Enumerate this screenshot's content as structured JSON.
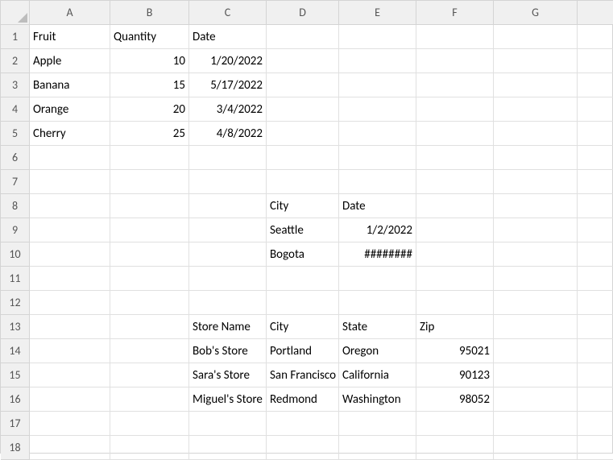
{
  "columns": [
    "A",
    "B",
    "C",
    "D",
    "E",
    "F",
    "G",
    ""
  ],
  "rows": [
    "1",
    "2",
    "3",
    "4",
    "5",
    "6",
    "7",
    "8",
    "9",
    "10",
    "11",
    "12",
    "13",
    "14",
    "15",
    "16",
    "17",
    "18"
  ],
  "cells": {
    "r1": {
      "A": "Fruit",
      "B": "Quantity",
      "C": "Date"
    },
    "r2": {
      "A": "Apple",
      "B": "10",
      "C": "1/20/2022"
    },
    "r3": {
      "A": "Banana",
      "B": "15",
      "C": "5/17/2022"
    },
    "r4": {
      "A": "Orange",
      "B": "20",
      "C": "3/4/2022"
    },
    "r5": {
      "A": "Cherry",
      "B": "25",
      "C": "4/8/2022"
    },
    "r8": {
      "D": "City",
      "E": "Date"
    },
    "r9": {
      "D": "Seattle",
      "E": "1/2/2022"
    },
    "r10": {
      "D": "Bogota",
      "E": "########"
    },
    "r13": {
      "C": "Store Name",
      "D": "City",
      "E": "State",
      "F": "Zip"
    },
    "r14": {
      "C": "Bob's Store",
      "D": "Portland",
      "E": "Oregon",
      "F": "95021"
    },
    "r15": {
      "C": "Sara's Store",
      "D": "San Francisco",
      "E": "California",
      "F": "90123"
    },
    "r16": {
      "C": "Miguel's Store",
      "D": "Redmond",
      "E": "Washington",
      "F": "98052"
    }
  },
  "chart_data": [
    {
      "type": "table",
      "title": "Fruit Quantities",
      "columns": [
        "Fruit",
        "Quantity",
        "Date"
      ],
      "rows": [
        [
          "Apple",
          10,
          "1/20/2022"
        ],
        [
          "Banana",
          15,
          "5/17/2022"
        ],
        [
          "Orange",
          20,
          "3/4/2022"
        ],
        [
          "Cherry",
          25,
          "4/8/2022"
        ]
      ]
    },
    {
      "type": "table",
      "title": "City Dates",
      "columns": [
        "City",
        "Date"
      ],
      "rows": [
        [
          "Seattle",
          "1/2/2022"
        ],
        [
          "Bogota",
          "########"
        ]
      ]
    },
    {
      "type": "table",
      "title": "Stores",
      "columns": [
        "Store Name",
        "City",
        "State",
        "Zip"
      ],
      "rows": [
        [
          "Bob's Store",
          "Portland",
          "Oregon",
          95021
        ],
        [
          "Sara's Store",
          "San Francisco",
          "California",
          90123
        ],
        [
          "Miguel's Store",
          "Redmond",
          "Washington",
          98052
        ]
      ]
    }
  ]
}
